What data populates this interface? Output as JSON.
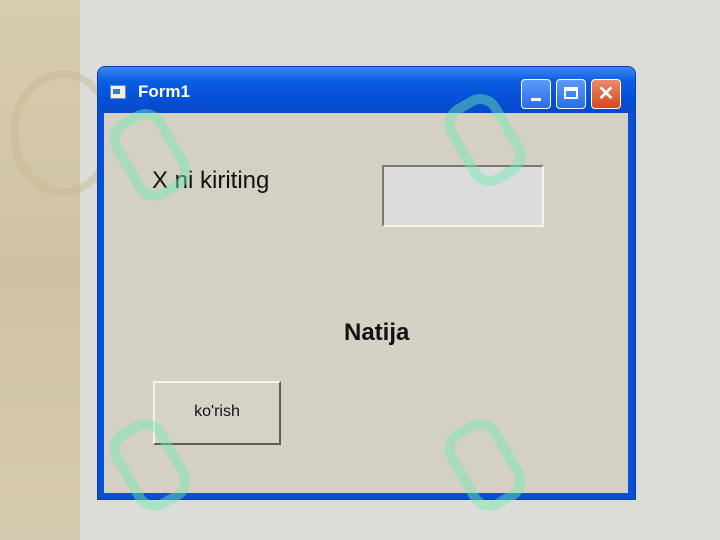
{
  "window": {
    "title": "Form1",
    "icons": {
      "app": "form-icon",
      "minimize": "minimize-icon",
      "maximize": "maximize-icon",
      "close": "close-icon"
    },
    "close_glyph": "✕",
    "colors": {
      "titlebar": "#0550d8",
      "client": "#d4d0c4",
      "close": "#d8471c"
    }
  },
  "form": {
    "x_label": "X ni kiriting",
    "x_input_value": "",
    "result_label": "Natija",
    "button_label": "ko'rish"
  }
}
